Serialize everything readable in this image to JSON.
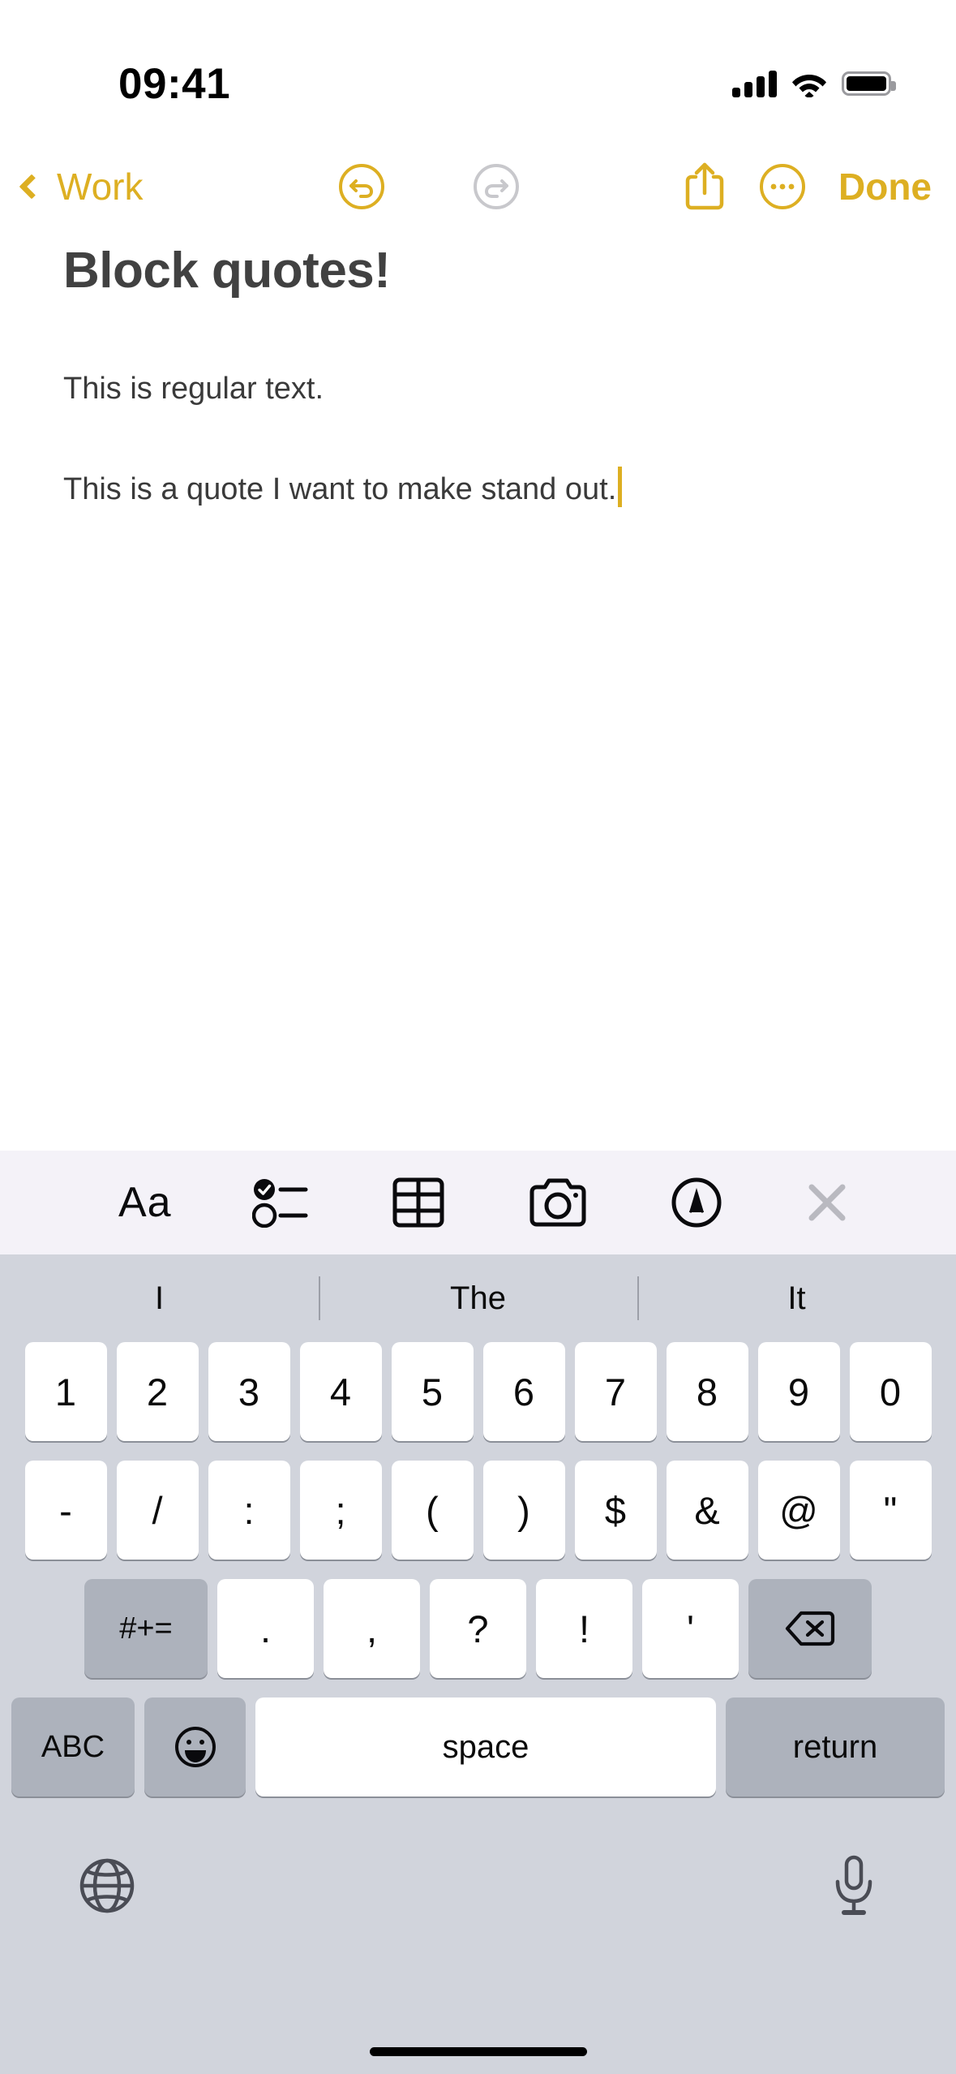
{
  "status_bar": {
    "time": "09:41",
    "cellular_icon": "signal-bars-icon",
    "wifi_icon": "wifi-icon",
    "battery_icon": "battery-full-icon"
  },
  "nav_bar": {
    "back_label": "Work",
    "back_icon": "chevron-left-icon",
    "undo_icon": "undo-circle-icon",
    "redo_icon": "redo-circle-icon",
    "share_icon": "share-up-icon",
    "more_icon": "ellipsis-circle-icon",
    "done_label": "Done",
    "accent_color": "#DDAF22",
    "disabled_color": "#C8C8CC"
  },
  "note": {
    "title": "Block quotes!",
    "paragraph_1": "This is regular text.",
    "paragraph_2": "This is a quote I want to make stand out.",
    "cursor_color": "#DDAF22",
    "title_color": "#414141",
    "body_color": "#3A3A3A"
  },
  "format_toolbar": {
    "background": "#F4F2F8",
    "items": [
      {
        "label": "Aa",
        "icon": "text-format-icon"
      },
      {
        "label": "",
        "icon": "checklist-icon"
      },
      {
        "label": "",
        "icon": "table-icon"
      },
      {
        "label": "",
        "icon": "camera-icon"
      },
      {
        "label": "",
        "icon": "markup-pen-icon"
      },
      {
        "label": "",
        "icon": "close-x-icon"
      }
    ]
  },
  "keyboard": {
    "background": "#D1D4DC",
    "key_color": "#FFFFFF",
    "modifier_key_color": "#ADB2BC",
    "predictions": [
      "I",
      "The",
      "It"
    ],
    "row1": [
      "1",
      "2",
      "3",
      "4",
      "5",
      "6",
      "7",
      "8",
      "9",
      "0"
    ],
    "row2": [
      "-",
      "/",
      ":",
      ";",
      "(",
      ")",
      "$",
      "&",
      "@",
      "\""
    ],
    "row3": {
      "symbol_toggle": "#+=",
      "chars": [
        ".",
        ",",
        "?",
        "!",
        "'"
      ],
      "backspace_icon": "backspace-icon"
    },
    "row4": {
      "abc": "ABC",
      "emoji_icon": "emoji-smiley-icon",
      "space": "space",
      "return": "return"
    },
    "globe_icon": "globe-icon",
    "mic_icon": "microphone-icon"
  },
  "home_indicator": "home-indicator"
}
